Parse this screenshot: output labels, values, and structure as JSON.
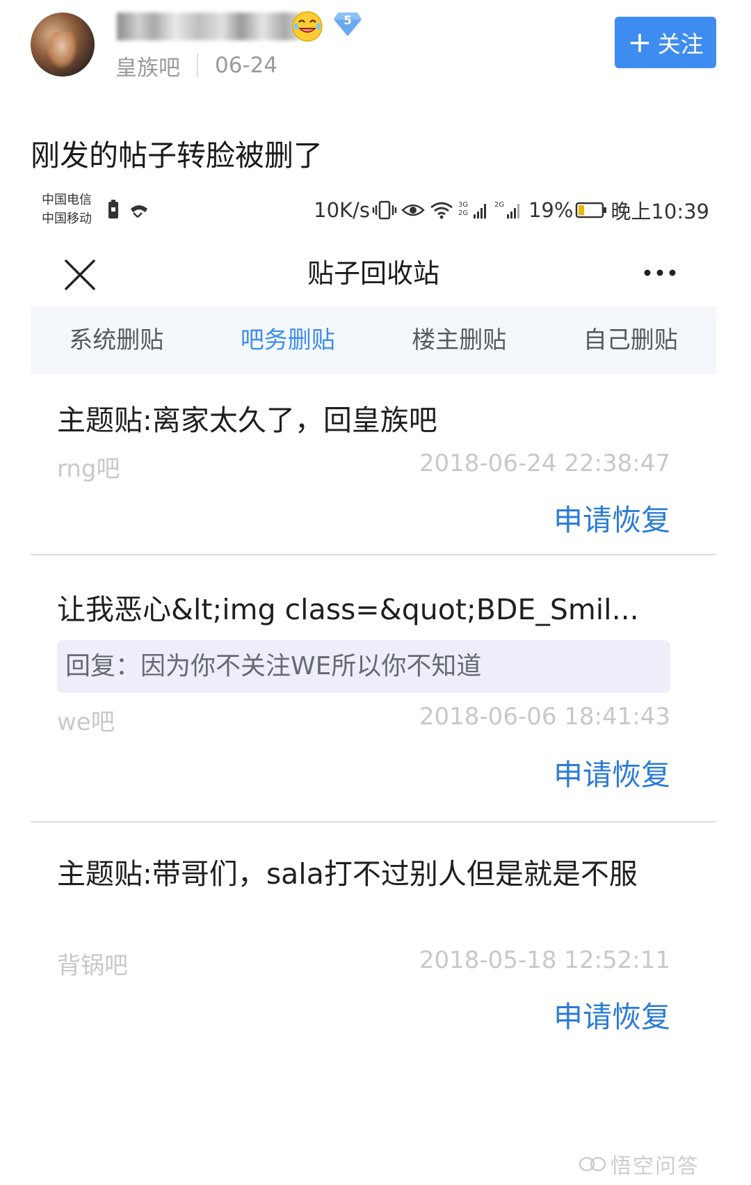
{
  "post": {
    "forum": "皇族吧",
    "date": "06-24",
    "level": "5",
    "follow_label": "关注",
    "follow_plus": "+",
    "text": "刚发的帖子转脸被删了"
  },
  "status_bar": {
    "carrier1": "中国电信",
    "carrier2": "中国移动",
    "speed": "10K/s",
    "net1": "3G",
    "net1b": "2G",
    "net2": "2G",
    "battery": "19%",
    "time": "晚上10:39"
  },
  "nav": {
    "title": "贴子回收站"
  },
  "tabs": [
    {
      "label": "系统删贴",
      "active": false
    },
    {
      "label": "吧务删贴",
      "active": true
    },
    {
      "label": "楼主删贴",
      "active": false
    },
    {
      "label": "自己删贴",
      "active": false
    }
  ],
  "items": [
    {
      "title": "主题贴:离家太久了，回皇族吧",
      "forum": "rng吧",
      "time": "2018-06-24 22:38:47",
      "action": "申请恢复"
    },
    {
      "title": "让我恶心&lt;img class=&quot;BDE_Smil...",
      "reply": "回复：因为你不关注WE所以你不知道",
      "forum": "we吧",
      "time": "2018-06-06 18:41:43",
      "action": "申请恢复"
    },
    {
      "title": "主题贴:带哥们，sala打不过别人但是就是不服",
      "forum": "背锅吧",
      "time": "2018-05-18 12:52:11",
      "action": "申请恢复"
    }
  ],
  "watermark": "悟空问答",
  "colors": {
    "accent": "#3e8cf0",
    "restore": "#2a7bd8",
    "tab_bg": "#f4f8fd",
    "reply_bg": "#edeefa"
  }
}
